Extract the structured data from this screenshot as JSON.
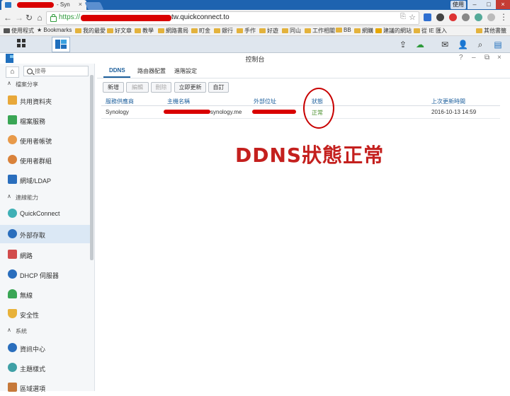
{
  "browser": {
    "tab_title": "- Syn",
    "tab_close": "×",
    "profile": "使用",
    "window_min": "–",
    "window_max": "□",
    "window_close": "×",
    "url_scheme": "https://",
    "url_host": "tw.quickconnect.to"
  },
  "bookmarks": [
    "使用程式",
    "Bookmarks",
    "我的最愛",
    "好文章",
    "教學",
    "網路書局",
    "町金",
    "銀行",
    "手作",
    "好遊",
    "同山",
    "工作相關",
    "BB",
    "網購",
    "建議的網站",
    "從 IE 匯入",
    "其他書籤"
  ],
  "dsm": {
    "window_title": "控制台",
    "sidebar": {
      "search_placeholder": "搜尋",
      "sections": {
        "file_sharing": "檔案分享",
        "connectivity": "連線能力",
        "system": "系統"
      },
      "items": {
        "shared_folder": "共用資料夾",
        "file_services": "檔案服務",
        "user": "使用者帳號",
        "group": "使用者群組",
        "domain_ldap": "網域/LDAP",
        "quickconnect": "QuickConnect",
        "external_access": "外部存取",
        "network": "網路",
        "dhcp": "DHCP 伺服器",
        "wireless": "無線",
        "security": "安全性",
        "info_center": "資訊中心",
        "theme": "主題樣式",
        "region": "區域選項"
      }
    },
    "tabs": [
      "DDNS",
      "路由器配置",
      "進階設定"
    ],
    "toolbar": [
      "新增",
      "編輯",
      "刪除",
      "立即更新",
      "自訂"
    ],
    "table": {
      "headers": [
        "服務供應商",
        "主機名稱",
        "外部位址",
        "狀態",
        "上次更新時間"
      ],
      "row": {
        "provider": "Synology",
        "hostname_suffix": "synology.me",
        "status": "正常",
        "last_update": "2016-10-13 14:59"
      }
    },
    "annotation": "DDNS狀態正常"
  },
  "colors": {
    "accent": "#1d5f9c",
    "annotation": "#c4201e",
    "status_ok": "#4a8f2c"
  }
}
